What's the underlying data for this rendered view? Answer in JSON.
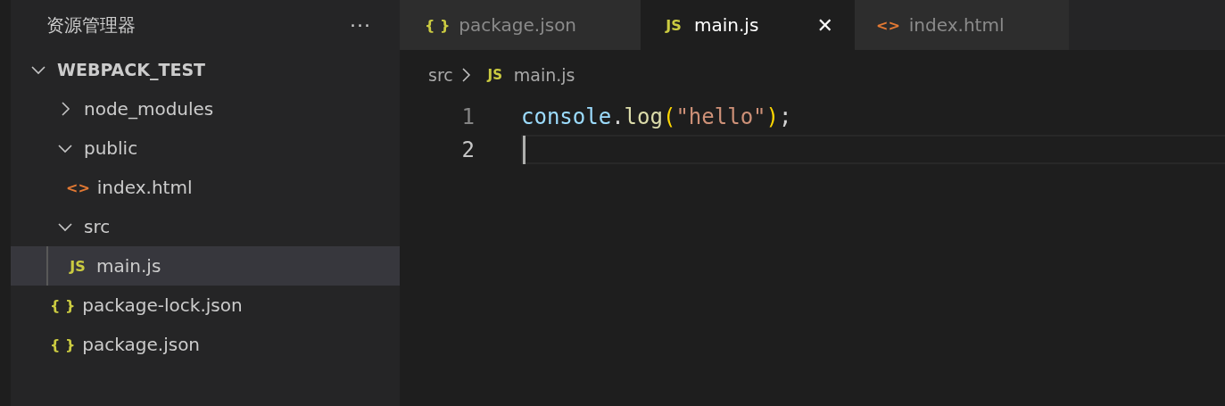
{
  "sidebar": {
    "title": "资源管理器",
    "more": "···",
    "tree": [
      {
        "label": "WEBPACK_TEST",
        "kind": "folder",
        "expanded": true,
        "selected": false,
        "children": [
          {
            "label": "node_modules",
            "kind": "folder",
            "expanded": false,
            "selected": false
          },
          {
            "label": "public",
            "kind": "folder",
            "expanded": true,
            "selected": false,
            "children": [
              {
                "label": "index.html",
                "kind": "file",
                "icon": "<>",
                "color": "#e37933",
                "selected": false
              }
            ]
          },
          {
            "label": "src",
            "kind": "folder",
            "expanded": true,
            "selected": false,
            "children": [
              {
                "label": "main.js",
                "kind": "file",
                "icon": "JS",
                "color": "#cbcb41",
                "selected": true
              }
            ]
          },
          {
            "label": "package-lock.json",
            "kind": "file",
            "icon": "{ }",
            "color": "#cbcb41",
            "selected": false
          },
          {
            "label": "package.json",
            "kind": "file",
            "icon": "{ }",
            "color": "#cbcb41",
            "selected": false
          }
        ]
      }
    ]
  },
  "tabs": [
    {
      "label": "package.json",
      "icon": "{ }",
      "color": "#cbcb41",
      "selected": false
    },
    {
      "label": "main.js",
      "icon": "JS",
      "color": "#cbcb41",
      "selected": true,
      "close": "✕"
    },
    {
      "label": "index.html",
      "icon": "<>",
      "color": "#e37933",
      "selected": false
    }
  ],
  "breadcrumb": [
    {
      "label": "src"
    },
    {
      "label": "main.js",
      "icon": "JS",
      "color": "#cbcb41"
    }
  ],
  "code": [
    {
      "number": "1",
      "current": false,
      "tokens": [
        {
          "text": "console",
          "kind": "variable"
        },
        {
          "text": ".",
          "kind": "plain"
        },
        {
          "text": "log",
          "kind": "function"
        },
        {
          "text": "(",
          "kind": "bracket"
        },
        {
          "text": "\"hello\"",
          "kind": "string"
        },
        {
          "text": ")",
          "kind": "bracket"
        },
        {
          "text": ";",
          "kind": "plain"
        }
      ]
    },
    {
      "number": "2",
      "current": true
    }
  ]
}
